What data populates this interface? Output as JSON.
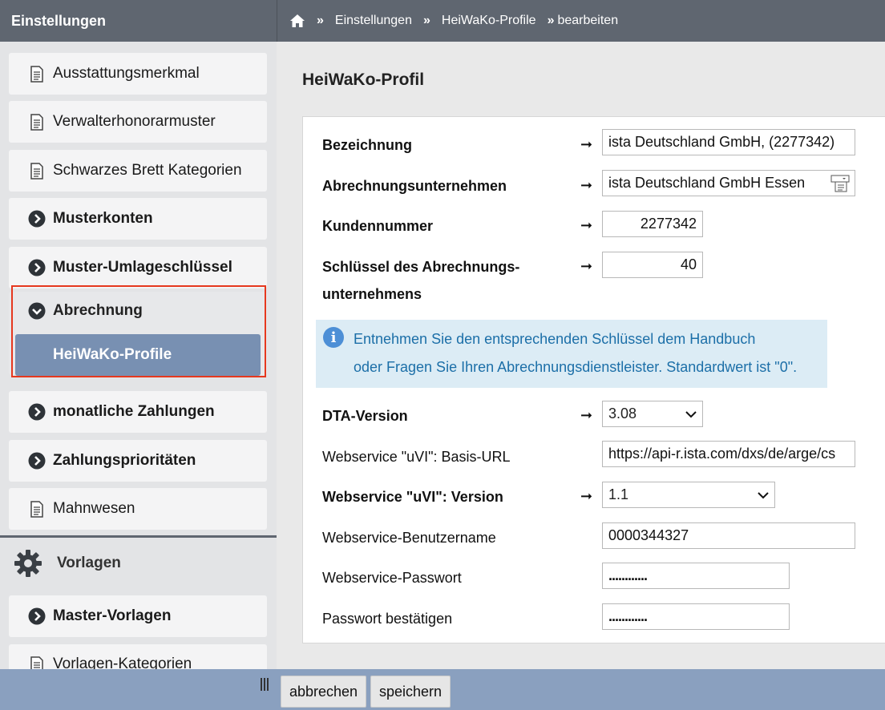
{
  "sidebar": {
    "header": "Einstellungen",
    "items": [
      {
        "label": "Ausstattungsmerkmal",
        "icon": "document-icon"
      },
      {
        "label": "Verwalterhonorarmuster",
        "icon": "document-icon"
      },
      {
        "label": "Schwarzes Brett Kategorien",
        "icon": "document-icon"
      },
      {
        "label": "Musterkonten",
        "icon": "chevron-right-circle-icon"
      },
      {
        "label": "Muster-Umlageschlüssel",
        "icon": "chevron-right-circle-icon"
      },
      {
        "label": "monatliche Zahlungen",
        "icon": "chevron-right-circle-icon"
      },
      {
        "label": "Zahlungsprioritäten",
        "icon": "chevron-right-circle-icon"
      },
      {
        "label": "Mahnwesen",
        "icon": "document-icon"
      }
    ],
    "group": {
      "label": "Abrechnung",
      "icon": "chevron-down-circle-icon",
      "subitem": "HeiWaKo-Profile"
    },
    "section": {
      "label": "Vorlagen",
      "icon": "gear-icon"
    },
    "section_items": [
      {
        "label": "Master-Vorlagen",
        "icon": "chevron-right-circle-icon"
      },
      {
        "label": "Vorlagen-Kategorien",
        "icon": "document-icon"
      }
    ]
  },
  "breadcrumb": {
    "home_icon": "home-icon",
    "sep": "»",
    "items": [
      "Einstellungen",
      "HeiWaKo-Profile",
      "bearbeiten"
    ]
  },
  "page": {
    "title": "HeiWaKo-Profil"
  },
  "form": {
    "arrow": "➞",
    "bezeichnung": {
      "label": "Bezeichnung",
      "value": "ista Deutschland GmbH, (2277342)"
    },
    "abrechnungsunternehmen": {
      "label": "Abrechnungsunternehmen",
      "value": "ista Deutschland GmbH Essen"
    },
    "kundennummer": {
      "label": "Kundennummer",
      "value": "2277342"
    },
    "schluessel": {
      "label_line1": "Schlüssel des Abrechnungs-",
      "label_line2": "unternehmens",
      "value": "40"
    },
    "info": {
      "line1": "Entnehmen Sie den entsprechenden Schlüssel dem Handbuch",
      "line2": "oder Fragen Sie Ihren Abrechnungsdienstleister. Standardwert ist \"0\"."
    },
    "dta_version": {
      "label": "DTA-Version",
      "value": "3.08"
    },
    "basis_url": {
      "label": "Webservice \"uVI\": Basis-URL",
      "value": "https://api-r.ista.com/dxs/de/arge/cs"
    },
    "uvi_version": {
      "label": "Webservice \"uVI\": Version",
      "value": "1.1"
    },
    "benutzername": {
      "label": "Webservice-Benutzername",
      "value": "0000344327"
    },
    "passwort": {
      "label": "Webservice-Passwort",
      "value": "............"
    },
    "passwort_bestaetigen": {
      "label": "Passwort bestätigen",
      "value": "............"
    }
  },
  "toolbar": {
    "cancel_label": "abbrechen",
    "save_label": "speichern"
  },
  "colors": {
    "header_bg": "#5f6670",
    "active_item": "#7890b2",
    "highlight_border": "#e6381f",
    "info_text": "#1c6fa8",
    "bottom_bar": "#8aa0bf"
  }
}
